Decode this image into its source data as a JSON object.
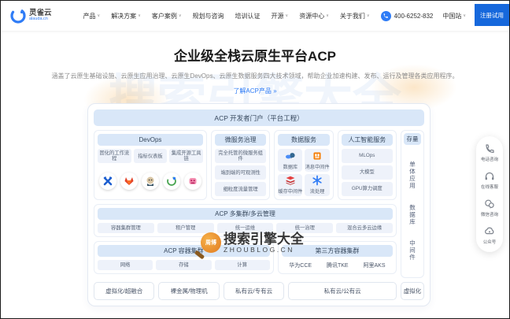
{
  "colors": {
    "accent": "#1668dc",
    "link_blue": "#2f7cf6",
    "panel_blue": "#d9e7f8",
    "chip_bg": "#eef2fa"
  },
  "brand": {
    "name": "灵雀云",
    "domain": "alauda.cn"
  },
  "header": {
    "nav": [
      {
        "label": "产品",
        "dropdown": true
      },
      {
        "label": "解决方案",
        "dropdown": true
      },
      {
        "label": "客户案例",
        "dropdown": true
      },
      {
        "label": "规划与咨询",
        "dropdown": false
      },
      {
        "label": "培训认证",
        "dropdown": false
      },
      {
        "label": "开源",
        "dropdown": true
      },
      {
        "label": "资源中心",
        "dropdown": true
      },
      {
        "label": "关于我们",
        "dropdown": true
      }
    ],
    "phone": "400-6252-832",
    "region": "中国站",
    "cta_label": "注册试用"
  },
  "hero": {
    "title": "企业级全栈云原生平台ACP",
    "subtitle": "涵盖了云原生基础设施、云原生应用治理、云原生DevOps、云原生数据服务四大技术领域，帮助企业加速构建、发布、运行及管理各类应用程序。",
    "link": "了解ACP产品 »"
  },
  "diagram": {
    "portal": "ACP 开发者门户（平台工程）",
    "columns": [
      {
        "title": "DevOps",
        "chips": [
          "固化的工作流程",
          "指标仪表板",
          "集成开源工具链"
        ],
        "tools": [
          "argo",
          "gitlab",
          "jenkins",
          "sonarqube",
          "tekton"
        ]
      },
      {
        "title": "微服务治理",
        "chips": [
          "完全托管的微服务组件",
          "端到端的可观测性",
          "细粒度流量管理"
        ]
      },
      {
        "title": "数据服务",
        "cells": [
          {
            "label": "数据库",
            "icon": "database"
          },
          {
            "label": "消息中间件",
            "icon": "mq"
          },
          {
            "label": "缓存中间件",
            "icon": "redis"
          },
          {
            "label": "流处理",
            "icon": "stream"
          }
        ]
      },
      {
        "title": "人工智能服务",
        "chips": [
          "MLOps",
          "大模型",
          "GPU算力调度"
        ]
      }
    ],
    "stock_column": {
      "title": "存量",
      "groups": [
        "单体应用",
        "数据库",
        "中间件"
      ]
    },
    "multicloud": {
      "title": "ACP 多集群/多云管理",
      "chips": [
        "容器集群管理",
        "租户管理",
        "统一运维",
        "统一治理",
        "混合云多云边缘"
      ]
    },
    "clusters": {
      "acp": {
        "title": "ACP 容器集群",
        "chips": [
          "网络",
          "存储",
          "计算"
        ]
      },
      "third_party": {
        "title": "第三方容器集群",
        "items": [
          "华为CCE",
          "腾讯TKE",
          "阿里AKS"
        ]
      }
    },
    "infra": [
      "虚拟化/超融合",
      "裸金属/物理机",
      "私有云/专有云",
      "私有云/公有云",
      "虚拟化"
    ]
  },
  "float_toolbar": {
    "items": [
      {
        "label": "电话咨询",
        "icon": "phone"
      },
      {
        "label": "在线客服",
        "icon": "headset"
      },
      {
        "label": "微信咨询",
        "icon": "wechat"
      },
      {
        "label": "公众号",
        "icon": "account"
      }
    ]
  },
  "watermark": {
    "ghost_text": "搜索引擎大全",
    "ghost_domain": "ZHOUBLOG.CN",
    "badge_title": "搜索引擎大全",
    "badge_domain": "ZHOUBLOG.CN",
    "seal_text": "周博"
  }
}
